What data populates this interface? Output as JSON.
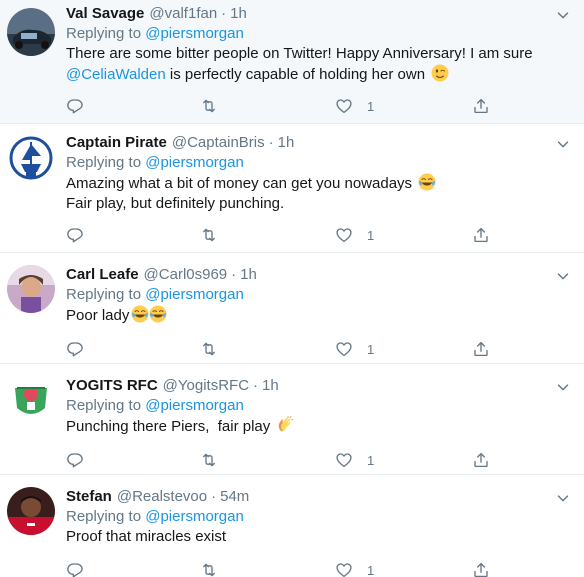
{
  "tweets": [
    {
      "name": "Val Savage",
      "handle": "@valf1fan",
      "dot": "·",
      "time": "1h",
      "replying_prefix": "Replying to",
      "replying_to": "@piersmorgan",
      "text_line1": "There are some bitter people on Twitter! Happy Anniversary! I am sure",
      "text_line2_link": "@CeliaWalden",
      "text_line2": " is perfectly capable of holding her own",
      "emoji": "winking-face",
      "likes": "1",
      "highlight": true
    },
    {
      "name": "Captain Pirate",
      "handle": "@CaptainBris",
      "dot": "·",
      "time": "1h",
      "replying_prefix": "Replying to",
      "replying_to": "@piersmorgan",
      "text_line1": "Amazing what a bit of money can get you nowadays",
      "emoji": "tears-of-joy",
      "text_line2": "Fair play, but definitely punching.",
      "likes": "1"
    },
    {
      "name": "Carl Leafe",
      "handle": "@Carl0s969",
      "dot": "·",
      "time": "1h",
      "replying_prefix": "Replying to",
      "replying_to": "@piersmorgan",
      "text_line1": "Poor lady",
      "emoji": "tears-of-joy x2",
      "likes": "1"
    },
    {
      "name": "YOGITS RFC",
      "handle": "@YogitsRFC",
      "dot": "·",
      "time": "1h",
      "replying_prefix": "Replying to",
      "replying_to": "@piersmorgan",
      "text_line1": "Punching there Piers,  fair play",
      "emoji": "clapping-hands",
      "likes": "1"
    },
    {
      "name": "Stefan",
      "handle": "@Realstevoo",
      "dot": "·",
      "time": "54m",
      "replying_prefix": "Replying to",
      "replying_to": "@piersmorgan",
      "text_line1": "Proof that miracles exist",
      "likes": "1"
    }
  ],
  "colors": {
    "link": "#1b95e0",
    "secondary": "#657786",
    "highlight_bg": "#f5f8fa",
    "divider": "#e6ecf0"
  }
}
